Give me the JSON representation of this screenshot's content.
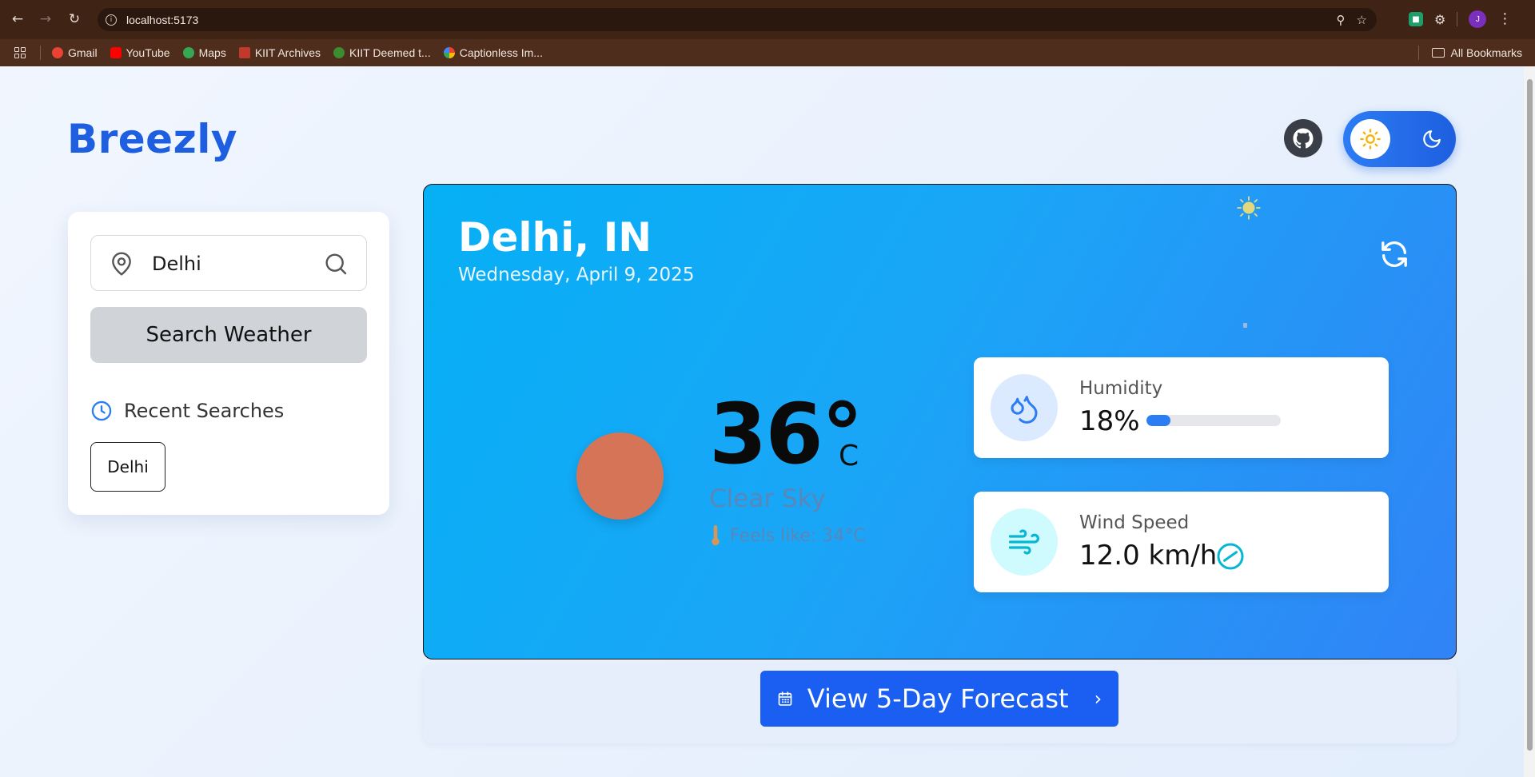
{
  "browser": {
    "url": "localhost:5173",
    "avatar_initial": "J",
    "bookmarks": [
      {
        "label": "Gmail",
        "color": "#ea4335"
      },
      {
        "label": "YouTube",
        "color": "#ff0000"
      },
      {
        "label": "Maps",
        "color": "#34a853"
      },
      {
        "label": "KIIT Archives",
        "color": "#c0392b"
      },
      {
        "label": "KIIT Deemed t...",
        "color": "#3c8d2f"
      },
      {
        "label": "Captionless Im...",
        "color": "#fbbc05"
      }
    ],
    "all_bookmarks": "All Bookmarks"
  },
  "app": {
    "brand": "Breezly",
    "accent": "#1d5fe0"
  },
  "search": {
    "value": "Delhi",
    "button": "Search Weather",
    "recent_title": "Recent Searches",
    "recent": [
      "Delhi"
    ]
  },
  "weather": {
    "city": "Delhi, IN",
    "date": "Wednesday, April 9, 2025",
    "temp": "36°",
    "unit": "C",
    "condition": "Clear Sky",
    "feels_like": "Feels like: 34°C",
    "humidity": {
      "label": "Humidity",
      "value": "18%",
      "percent": 18
    },
    "wind": {
      "label": "Wind Speed",
      "value": "12.0 km/h"
    }
  },
  "forecast": {
    "button": "View 5-Day Forecast"
  }
}
